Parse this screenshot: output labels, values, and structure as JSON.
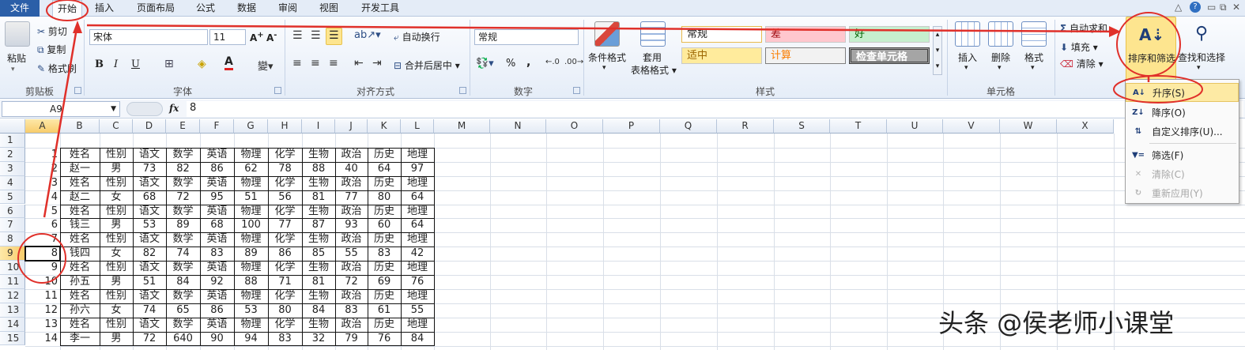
{
  "tabs": {
    "file": "文件",
    "home": "开始",
    "insert": "插入",
    "page_layout": "页面布局",
    "formula": "公式",
    "data": "数据",
    "review": "审阅",
    "view": "视图",
    "developer": "开发工具"
  },
  "clipboard": {
    "paste": "粘贴",
    "cut": "剪切",
    "copy": "复制",
    "format_painter": "格式刷",
    "group": "剪贴板"
  },
  "font": {
    "name": "宋体",
    "size": "11",
    "group": "字体",
    "bold": "B",
    "italic": "I",
    "underline": "U",
    "color_letter": "A"
  },
  "alignment": {
    "wrap": "自动换行",
    "merge": "合并后居中",
    "group": "对齐方式"
  },
  "number": {
    "format": "常规",
    "percent": "%",
    "comma": ",",
    "group": "数字"
  },
  "styles": {
    "conditional": "条件格式",
    "table_1": "套用",
    "table_2": "表格格式",
    "normal": "常规",
    "bad": "差",
    "good": "好",
    "neutral": "适中",
    "calc": "计算",
    "check": "检查单元格",
    "group": "样式"
  },
  "cells": {
    "insert": "插入",
    "delete": "删除",
    "format": "格式",
    "group": "单元格"
  },
  "editing": {
    "autosum": "自动求和",
    "fill": "填充",
    "clear": "清除",
    "sort_filter": "排序和筛选",
    "find_select": "查找和选择"
  },
  "formula_bar": {
    "name_box": "A9",
    "fx": "fx",
    "value": "8"
  },
  "columns": [
    "A",
    "B",
    "C",
    "D",
    "E",
    "F",
    "G",
    "H",
    "I",
    "J",
    "K",
    "L",
    "M",
    "N",
    "O",
    "P",
    "Q",
    "R",
    "S",
    "T",
    "U",
    "V",
    "W",
    "X"
  ],
  "rows": [
    "1",
    "2",
    "3",
    "4",
    "5",
    "6",
    "7",
    "8",
    "9",
    "10",
    "11",
    "12",
    "13",
    "14",
    "15"
  ],
  "table": [
    [
      "",
      "",
      "",
      "",
      "",
      "",
      "",
      "",
      "",
      "",
      "",
      ""
    ],
    [
      "1",
      "姓名",
      "性别",
      "语文",
      "数学",
      "英语",
      "物理",
      "化学",
      "生物",
      "政治",
      "历史",
      "地理"
    ],
    [
      "2",
      "赵一",
      "男",
      "73",
      "82",
      "86",
      "62",
      "78",
      "88",
      "40",
      "64",
      "97"
    ],
    [
      "3",
      "姓名",
      "性别",
      "语文",
      "数学",
      "英语",
      "物理",
      "化学",
      "生物",
      "政治",
      "历史",
      "地理"
    ],
    [
      "4",
      "赵二",
      "女",
      "68",
      "72",
      "95",
      "51",
      "56",
      "81",
      "77",
      "80",
      "64"
    ],
    [
      "5",
      "姓名",
      "性别",
      "语文",
      "数学",
      "英语",
      "物理",
      "化学",
      "生物",
      "政治",
      "历史",
      "地理"
    ],
    [
      "6",
      "钱三",
      "男",
      "53",
      "89",
      "68",
      "100",
      "77",
      "87",
      "93",
      "60",
      "64"
    ],
    [
      "7",
      "姓名",
      "性别",
      "语文",
      "数学",
      "英语",
      "物理",
      "化学",
      "生物",
      "政治",
      "历史",
      "地理"
    ],
    [
      "8",
      "钱四",
      "女",
      "82",
      "74",
      "83",
      "89",
      "86",
      "85",
      "55",
      "83",
      "42"
    ],
    [
      "9",
      "姓名",
      "性别",
      "语文",
      "数学",
      "英语",
      "物理",
      "化学",
      "生物",
      "政治",
      "历史",
      "地理"
    ],
    [
      "10",
      "孙五",
      "男",
      "51",
      "84",
      "92",
      "88",
      "71",
      "81",
      "72",
      "69",
      "76"
    ],
    [
      "11",
      "姓名",
      "性别",
      "语文",
      "数学",
      "英语",
      "物理",
      "化学",
      "生物",
      "政治",
      "历史",
      "地理"
    ],
    [
      "12",
      "孙六",
      "女",
      "74",
      "65",
      "86",
      "53",
      "80",
      "84",
      "83",
      "61",
      "55"
    ],
    [
      "13",
      "姓名",
      "性别",
      "语文",
      "数学",
      "英语",
      "物理",
      "化学",
      "生物",
      "政治",
      "历史",
      "地理"
    ],
    [
      "14",
      "李一",
      "男",
      "72",
      "640",
      "90",
      "94",
      "83",
      "32",
      "79",
      "76",
      "84"
    ]
  ],
  "sort_menu": [
    {
      "icon": "sort-ascending-icon",
      "glyph": "A↓",
      "label": "升序(S)",
      "disabled": false,
      "active": true
    },
    {
      "icon": "sort-descending-icon",
      "glyph": "Z↓",
      "label": "降序(O)",
      "disabled": false,
      "active": false
    },
    {
      "icon": "custom-sort-icon",
      "glyph": "⇅",
      "label": "自定义排序(U)...",
      "disabled": false,
      "active": false
    },
    {
      "icon": "filter-icon",
      "glyph": "▼=",
      "label": "筛选(F)",
      "disabled": false,
      "active": false
    },
    {
      "icon": "clear-filter-icon",
      "glyph": "✕",
      "label": "清除(C)",
      "disabled": true,
      "active": false
    },
    {
      "icon": "reapply-icon",
      "glyph": "↻",
      "label": "重新应用(Y)",
      "disabled": true,
      "active": false
    }
  ],
  "watermark": "头条 @侯老师小课堂",
  "colors": {
    "annotation": "#e0302a",
    "file_tab": "#2b5fa8",
    "highlight": "#fde58f"
  }
}
